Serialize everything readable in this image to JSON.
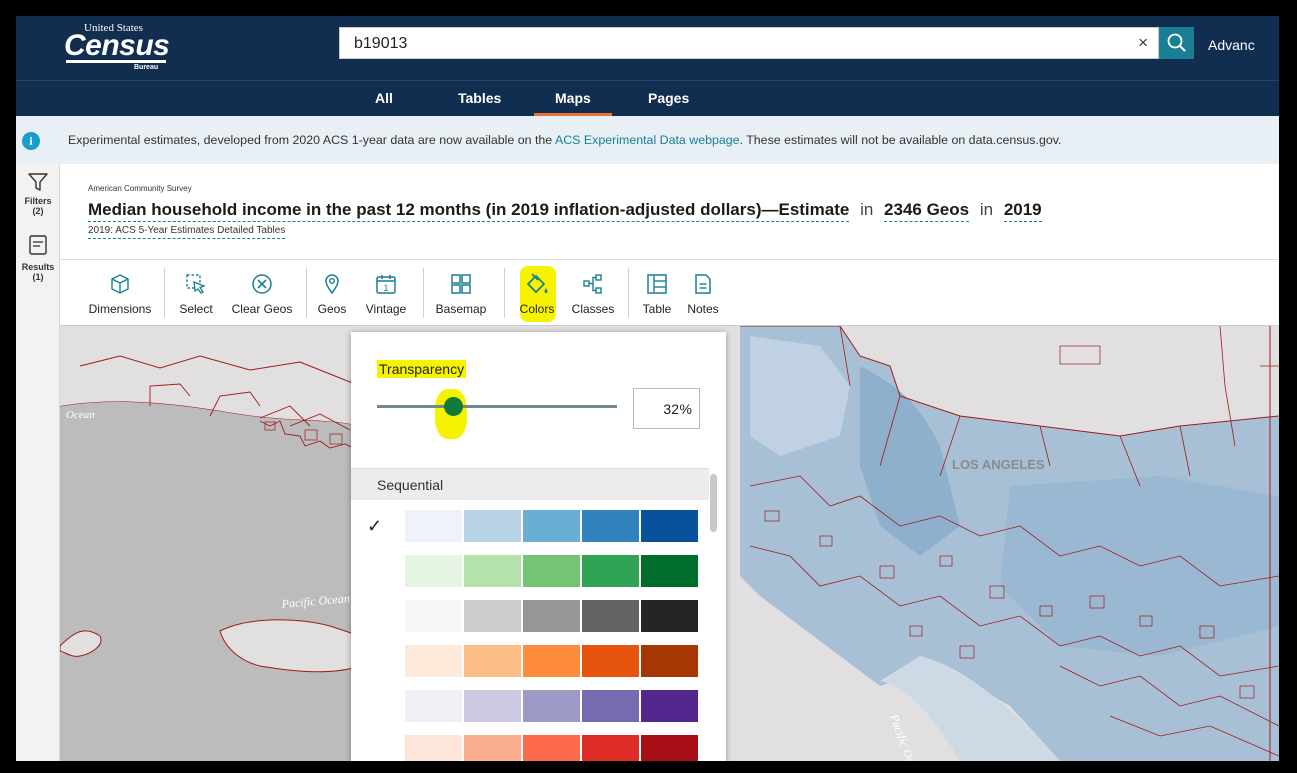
{
  "header": {
    "logo_top": "United States",
    "logo_main": "Census",
    "logo_bottom": "Bureau",
    "search_value": "b19013",
    "clear_label": "×",
    "advanced_label": "Advanc"
  },
  "nav": {
    "tabs": [
      "All",
      "Tables",
      "Maps",
      "Pages"
    ],
    "active_tab": "Maps"
  },
  "banner": {
    "icon": "i",
    "text_before": "Experimental estimates, developed from 2020 ACS 1-year data are now available on the ",
    "link_text": "ACS Experimental Data webpage",
    "text_after": ". These estimates will not be available on data.census.gov."
  },
  "rail": {
    "filters_label": "Filters",
    "filters_count": "(2)",
    "results_label": "Results",
    "results_count": "(1)"
  },
  "title": {
    "program": "American Community Survey",
    "main": "Median household income in the past 12 months (in 2019 inflation-adjusted dollars)—Estimate",
    "in_word": "in",
    "geos": "2346 Geos",
    "year": "2019",
    "subtitle": "2019: ACS 5-Year Estimates Detailed Tables"
  },
  "toolbar": {
    "items": [
      "Dimensions",
      "Select",
      "Clear Geos",
      "Geos",
      "Vintage",
      "Basemap",
      "Colors",
      "Classes",
      "Table",
      "Notes"
    ],
    "vintage_glyph": "1"
  },
  "map": {
    "labels": [
      "Ocean",
      "Pacific Ocean",
      "LOS ANGELES",
      "Pacific Ocean"
    ]
  },
  "color_panel": {
    "transparency_label": "Transparency",
    "transparency_value": "32",
    "transparency_fraction": 0.32,
    "percent_sign": "%",
    "ramp_group_label": "Sequential",
    "check_mark": "✓",
    "selected_ramp": 0,
    "ramps": [
      [
        "#eef3fb",
        "#b9d3e6",
        "#6aaed6",
        "#3182bd",
        "#08519c"
      ],
      [
        "#e6f4e3",
        "#b5e1ad",
        "#74c476",
        "#31a354",
        "#006d2c"
      ],
      [
        "#f7f7f7",
        "#cccccc",
        "#969696",
        "#636363",
        "#252525"
      ],
      [
        "#feeadb",
        "#fdbe85",
        "#fd8d3c",
        "#e6550d",
        "#a63603"
      ],
      [
        "#f1eff6",
        "#cbc9e2",
        "#9e9ac8",
        "#756bb1",
        "#54278f"
      ],
      [
        "#fee5d9",
        "#fcae91",
        "#fb6a4a",
        "#de2d26",
        "#a50f15"
      ]
    ]
  },
  "colors": {
    "navy": "#112e51",
    "teal": "#1a7f94",
    "orange_accent": "#e8743b",
    "highlight": "#f7f200",
    "thumb_green": "#0f7a3a",
    "map_land": "#e1dfdf",
    "map_water": "#bcbcbc",
    "tract_fill": "#a7c0d6",
    "tract_border": "#a01a1a"
  }
}
